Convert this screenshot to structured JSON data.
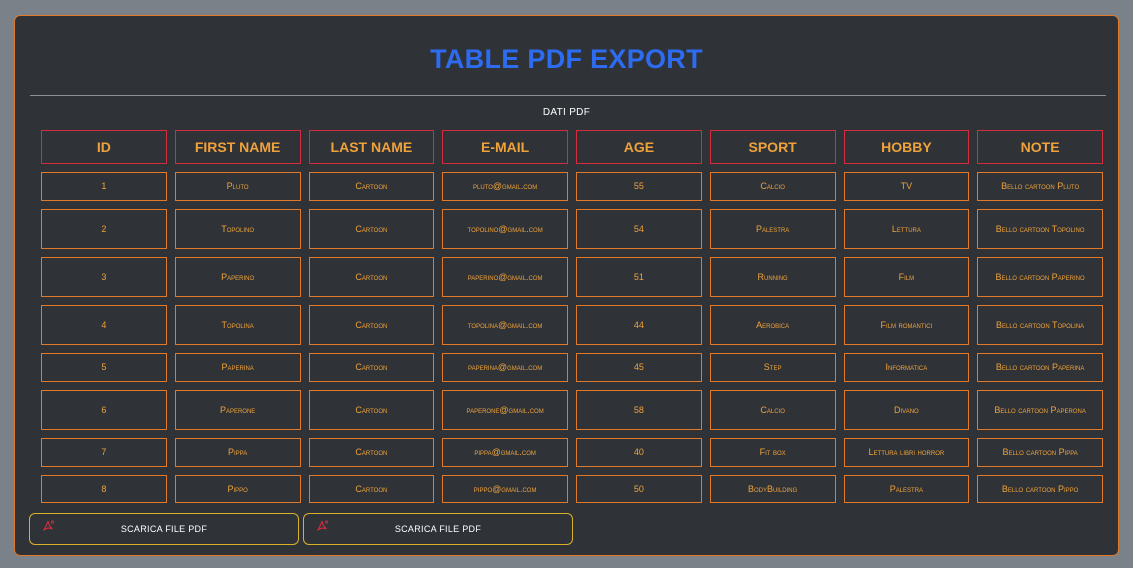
{
  "page": {
    "title": "TABLE PDF EXPORT",
    "caption": "DATI PDF"
  },
  "table": {
    "headers": [
      "ID",
      "FIRST NAME",
      "LAST NAME",
      "E-MAIL",
      "AGE",
      "SPORT",
      "HOBBY",
      "NOTE"
    ],
    "rows": [
      [
        "1",
        "Pluto",
        "Cartoon",
        "pluto@gmail.com",
        "55",
        "Calcio",
        "TV",
        "Bello cartoon Pluto"
      ],
      [
        "2",
        "Topolino",
        "Cartoon",
        "topolino@gmail.com",
        "54",
        "Palestra",
        "Lettura",
        "Bello cartoon Topolino"
      ],
      [
        "3",
        "Paperino",
        "Cartoon",
        "paperino@gmail.com",
        "51",
        "Running",
        "Film",
        "Bello cartoon Paperino"
      ],
      [
        "4",
        "Topolina",
        "Cartoon",
        "topolina@gmail.com",
        "44",
        "Aerobica",
        "Film romantici",
        "Bello cartoon Topolina"
      ],
      [
        "5",
        "Paperina",
        "Cartoon",
        "paperina@gmail.com",
        "45",
        "Step",
        "Informatica",
        "Bello cartoon Paperina"
      ],
      [
        "6",
        "Paperone",
        "Cartoon",
        "paperone@gmail.com",
        "58",
        "Calcio",
        "Divano",
        "Bello cartoon Paperona"
      ],
      [
        "7",
        "Pippa",
        "Cartoon",
        "pippa@gmail.com",
        "40",
        "Fit box",
        "Lettura libri horror",
        "Bello cartoon Pippa"
      ],
      [
        "8",
        "Pippo",
        "Cartoon",
        "pippo@gmail.com",
        "50",
        "BodyBuilding",
        "Palestra",
        "Bello cartoon Pippo"
      ]
    ]
  },
  "buttons": [
    {
      "label": "SCARICA FILE PDF",
      "icon": "pdf-icon"
    },
    {
      "label": "SCARICA FILE PDF",
      "icon": "pdf-icon"
    }
  ],
  "colors": {
    "accent_title": "#2d6bf0",
    "header_border": "#d42c3c",
    "cell_border": "#e07a2a",
    "text": "#f0a23a",
    "button_border": "#d8b02a"
  }
}
